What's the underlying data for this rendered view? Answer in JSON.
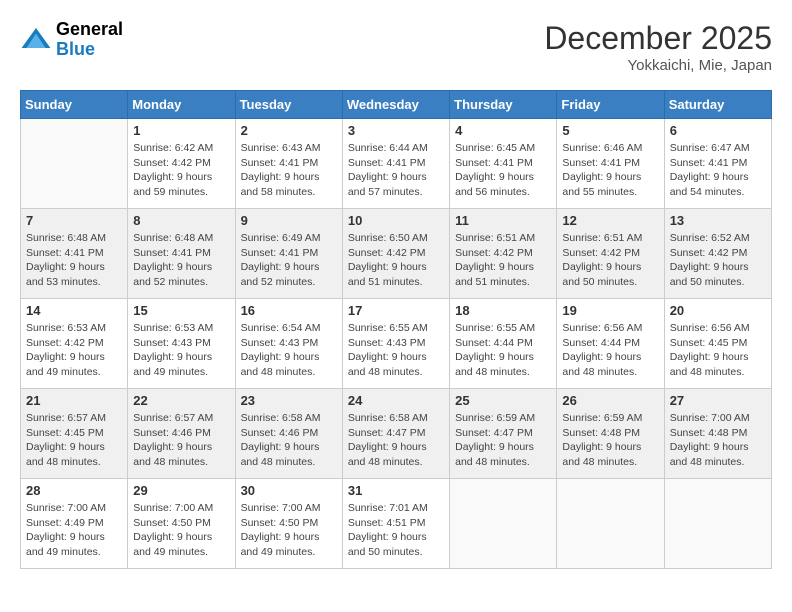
{
  "header": {
    "logo_general": "General",
    "logo_blue": "Blue",
    "month": "December 2025",
    "location": "Yokkaichi, Mie, Japan"
  },
  "weekdays": [
    "Sunday",
    "Monday",
    "Tuesday",
    "Wednesday",
    "Thursday",
    "Friday",
    "Saturday"
  ],
  "weeks": [
    [
      {
        "day": "",
        "sunrise": "",
        "sunset": "",
        "daylight": ""
      },
      {
        "day": "1",
        "sunrise": "Sunrise: 6:42 AM",
        "sunset": "Sunset: 4:42 PM",
        "daylight": "Daylight: 9 hours and 59 minutes."
      },
      {
        "day": "2",
        "sunrise": "Sunrise: 6:43 AM",
        "sunset": "Sunset: 4:41 PM",
        "daylight": "Daylight: 9 hours and 58 minutes."
      },
      {
        "day": "3",
        "sunrise": "Sunrise: 6:44 AM",
        "sunset": "Sunset: 4:41 PM",
        "daylight": "Daylight: 9 hours and 57 minutes."
      },
      {
        "day": "4",
        "sunrise": "Sunrise: 6:45 AM",
        "sunset": "Sunset: 4:41 PM",
        "daylight": "Daylight: 9 hours and 56 minutes."
      },
      {
        "day": "5",
        "sunrise": "Sunrise: 6:46 AM",
        "sunset": "Sunset: 4:41 PM",
        "daylight": "Daylight: 9 hours and 55 minutes."
      },
      {
        "day": "6",
        "sunrise": "Sunrise: 6:47 AM",
        "sunset": "Sunset: 4:41 PM",
        "daylight": "Daylight: 9 hours and 54 minutes."
      }
    ],
    [
      {
        "day": "7",
        "sunrise": "Sunrise: 6:48 AM",
        "sunset": "Sunset: 4:41 PM",
        "daylight": "Daylight: 9 hours and 53 minutes."
      },
      {
        "day": "8",
        "sunrise": "Sunrise: 6:48 AM",
        "sunset": "Sunset: 4:41 PM",
        "daylight": "Daylight: 9 hours and 52 minutes."
      },
      {
        "day": "9",
        "sunrise": "Sunrise: 6:49 AM",
        "sunset": "Sunset: 4:41 PM",
        "daylight": "Daylight: 9 hours and 52 minutes."
      },
      {
        "day": "10",
        "sunrise": "Sunrise: 6:50 AM",
        "sunset": "Sunset: 4:42 PM",
        "daylight": "Daylight: 9 hours and 51 minutes."
      },
      {
        "day": "11",
        "sunrise": "Sunrise: 6:51 AM",
        "sunset": "Sunset: 4:42 PM",
        "daylight": "Daylight: 9 hours and 51 minutes."
      },
      {
        "day": "12",
        "sunrise": "Sunrise: 6:51 AM",
        "sunset": "Sunset: 4:42 PM",
        "daylight": "Daylight: 9 hours and 50 minutes."
      },
      {
        "day": "13",
        "sunrise": "Sunrise: 6:52 AM",
        "sunset": "Sunset: 4:42 PM",
        "daylight": "Daylight: 9 hours and 50 minutes."
      }
    ],
    [
      {
        "day": "14",
        "sunrise": "Sunrise: 6:53 AM",
        "sunset": "Sunset: 4:42 PM",
        "daylight": "Daylight: 9 hours and 49 minutes."
      },
      {
        "day": "15",
        "sunrise": "Sunrise: 6:53 AM",
        "sunset": "Sunset: 4:43 PM",
        "daylight": "Daylight: 9 hours and 49 minutes."
      },
      {
        "day": "16",
        "sunrise": "Sunrise: 6:54 AM",
        "sunset": "Sunset: 4:43 PM",
        "daylight": "Daylight: 9 hours and 48 minutes."
      },
      {
        "day": "17",
        "sunrise": "Sunrise: 6:55 AM",
        "sunset": "Sunset: 4:43 PM",
        "daylight": "Daylight: 9 hours and 48 minutes."
      },
      {
        "day": "18",
        "sunrise": "Sunrise: 6:55 AM",
        "sunset": "Sunset: 4:44 PM",
        "daylight": "Daylight: 9 hours and 48 minutes."
      },
      {
        "day": "19",
        "sunrise": "Sunrise: 6:56 AM",
        "sunset": "Sunset: 4:44 PM",
        "daylight": "Daylight: 9 hours and 48 minutes."
      },
      {
        "day": "20",
        "sunrise": "Sunrise: 6:56 AM",
        "sunset": "Sunset: 4:45 PM",
        "daylight": "Daylight: 9 hours and 48 minutes."
      }
    ],
    [
      {
        "day": "21",
        "sunrise": "Sunrise: 6:57 AM",
        "sunset": "Sunset: 4:45 PM",
        "daylight": "Daylight: 9 hours and 48 minutes."
      },
      {
        "day": "22",
        "sunrise": "Sunrise: 6:57 AM",
        "sunset": "Sunset: 4:46 PM",
        "daylight": "Daylight: 9 hours and 48 minutes."
      },
      {
        "day": "23",
        "sunrise": "Sunrise: 6:58 AM",
        "sunset": "Sunset: 4:46 PM",
        "daylight": "Daylight: 9 hours and 48 minutes."
      },
      {
        "day": "24",
        "sunrise": "Sunrise: 6:58 AM",
        "sunset": "Sunset: 4:47 PM",
        "daylight": "Daylight: 9 hours and 48 minutes."
      },
      {
        "day": "25",
        "sunrise": "Sunrise: 6:59 AM",
        "sunset": "Sunset: 4:47 PM",
        "daylight": "Daylight: 9 hours and 48 minutes."
      },
      {
        "day": "26",
        "sunrise": "Sunrise: 6:59 AM",
        "sunset": "Sunset: 4:48 PM",
        "daylight": "Daylight: 9 hours and 48 minutes."
      },
      {
        "day": "27",
        "sunrise": "Sunrise: 7:00 AM",
        "sunset": "Sunset: 4:48 PM",
        "daylight": "Daylight: 9 hours and 48 minutes."
      }
    ],
    [
      {
        "day": "28",
        "sunrise": "Sunrise: 7:00 AM",
        "sunset": "Sunset: 4:49 PM",
        "daylight": "Daylight: 9 hours and 49 minutes."
      },
      {
        "day": "29",
        "sunrise": "Sunrise: 7:00 AM",
        "sunset": "Sunset: 4:50 PM",
        "daylight": "Daylight: 9 hours and 49 minutes."
      },
      {
        "day": "30",
        "sunrise": "Sunrise: 7:00 AM",
        "sunset": "Sunset: 4:50 PM",
        "daylight": "Daylight: 9 hours and 49 minutes."
      },
      {
        "day": "31",
        "sunrise": "Sunrise: 7:01 AM",
        "sunset": "Sunset: 4:51 PM",
        "daylight": "Daylight: 9 hours and 50 minutes."
      },
      {
        "day": "",
        "sunrise": "",
        "sunset": "",
        "daylight": ""
      },
      {
        "day": "",
        "sunrise": "",
        "sunset": "",
        "daylight": ""
      },
      {
        "day": "",
        "sunrise": "",
        "sunset": "",
        "daylight": ""
      }
    ]
  ]
}
